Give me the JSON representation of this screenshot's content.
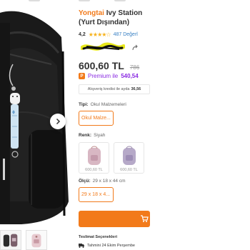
{
  "product": {
    "brand": "Yongtai",
    "title_rest": "Ivy Station",
    "title_line2": "(Yurt Dışından)",
    "rating": "4,2",
    "review_count": "487 Değerl",
    "price": "600,60 TL",
    "old_price": "786",
    "premium_label": "Premium ile",
    "premium_price": "540,54",
    "premium_badge": "P",
    "installment_text": "Alışveriş kredisi ile ayda",
    "installment_amount": "36,56"
  },
  "attributes": {
    "type_label": "Tipi:",
    "type_value": "Okul Malzemeleri",
    "type_chip": "Okul Malze...",
    "color_label": "Renk:",
    "color_value": "Siyah",
    "color_options": [
      {
        "price": "600,60 TL",
        "icon": "pink-backpack-icon",
        "color": "#d8b7c3"
      },
      {
        "price": "600,60 TL",
        "icon": "lavender-backpack-icon",
        "color": "#b6a9c8"
      }
    ],
    "size_label": "Ölçü:",
    "size_value": "29 x 18 x 44 cm",
    "size_chip": "29 x 18 x 4..."
  },
  "delivery": {
    "title": "Teslimat Seçenekleri",
    "estimate": "Tahmini 24 Ekim Perşembe"
  },
  "colors": {
    "accent": "#f27a1a",
    "premium": "#8a2be2",
    "star": "#f7b21b",
    "link": "#3b82c4"
  }
}
